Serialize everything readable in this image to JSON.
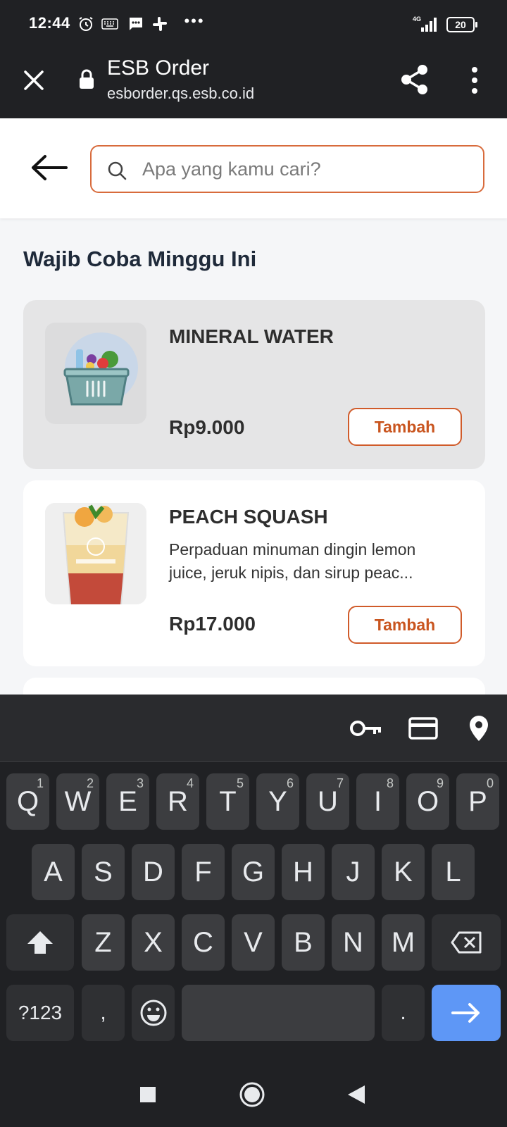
{
  "status_bar": {
    "time": "12:44",
    "network": "4G",
    "battery": "20"
  },
  "browser": {
    "title": "ESB Order",
    "url": "esborder.qs.esb.co.id"
  },
  "search": {
    "placeholder": "Apa yang kamu cari?"
  },
  "section": {
    "title": "Wajib Coba Minggu Ini"
  },
  "items": [
    {
      "name": "MINERAL WATER",
      "description": "",
      "price": "Rp9.000",
      "button_label": "Tambah",
      "image_icon": "grocery-basket-placeholder"
    },
    {
      "name": "PEACH SQUASH",
      "description": "Perpaduan minuman dingin lemon juice, jeruk nipis, dan sirup peac...",
      "price": "Rp17.000",
      "button_label": "Tambah",
      "image_icon": "drink-cup-photo"
    }
  ],
  "keyboard": {
    "row1": [
      {
        "label": "Q",
        "hint": "1"
      },
      {
        "label": "W",
        "hint": "2"
      },
      {
        "label": "E",
        "hint": "3"
      },
      {
        "label": "R",
        "hint": "4"
      },
      {
        "label": "T",
        "hint": "5"
      },
      {
        "label": "Y",
        "hint": "6"
      },
      {
        "label": "U",
        "hint": "7"
      },
      {
        "label": "I",
        "hint": "8"
      },
      {
        "label": "O",
        "hint": "9"
      },
      {
        "label": "P",
        "hint": "0"
      }
    ],
    "row2": [
      "A",
      "S",
      "D",
      "F",
      "G",
      "H",
      "J",
      "K",
      "L"
    ],
    "row3": [
      "Z",
      "X",
      "C",
      "V",
      "B",
      "N",
      "M"
    ],
    "symbols_label": "?123",
    "comma_label": ",",
    "period_label": ".",
    "suggest_icons": [
      "key-icon",
      "credit-card-icon",
      "location-pin-icon"
    ]
  },
  "colors": {
    "accent": "#d05b2a",
    "dark_bar": "#202124",
    "enter_key": "#5e97f6"
  }
}
